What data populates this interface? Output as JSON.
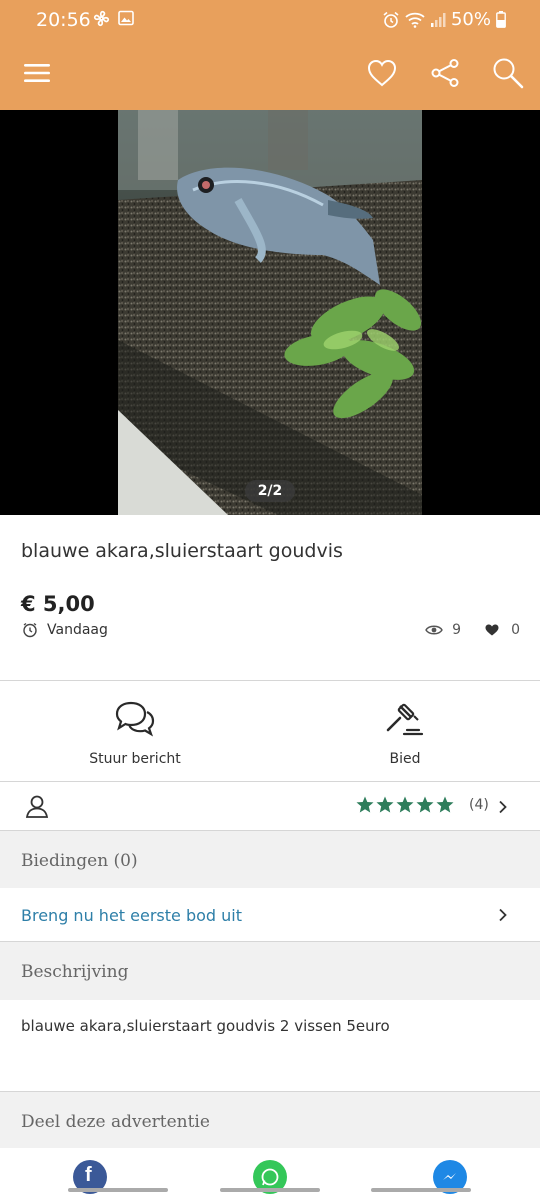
{
  "status": {
    "time": "20:56",
    "battery": "50%"
  },
  "app_bar": {
    "menu_icon": "hamburger-menu-icon",
    "favorite_icon": "heart-outline-icon",
    "share_icon": "share-icon",
    "search_icon": "search-icon"
  },
  "gallery": {
    "counter": "2/2"
  },
  "listing": {
    "title": "blauwe akara,sluierstaart goudvis",
    "price": "€ 5,00",
    "date": "Vandaag",
    "views": "9",
    "favorites": "0"
  },
  "actions": {
    "message_label": "Stuur bericht",
    "bid_label": "Bied"
  },
  "seller": {
    "rating_stars": 5,
    "review_count": "(4)"
  },
  "bids": {
    "heading": "Biedingen (0)",
    "cta": "Breng nu het eerste bod uit"
  },
  "description": {
    "heading": "Beschrijving",
    "text": "blauwe akara,sluierstaart goudvis 2 vissen 5euro"
  },
  "share": {
    "heading": "Deel deze advertentie"
  },
  "colors": {
    "accent": "#e8a05c",
    "link": "#2e7fa8",
    "stars": "#2e7d5b"
  }
}
